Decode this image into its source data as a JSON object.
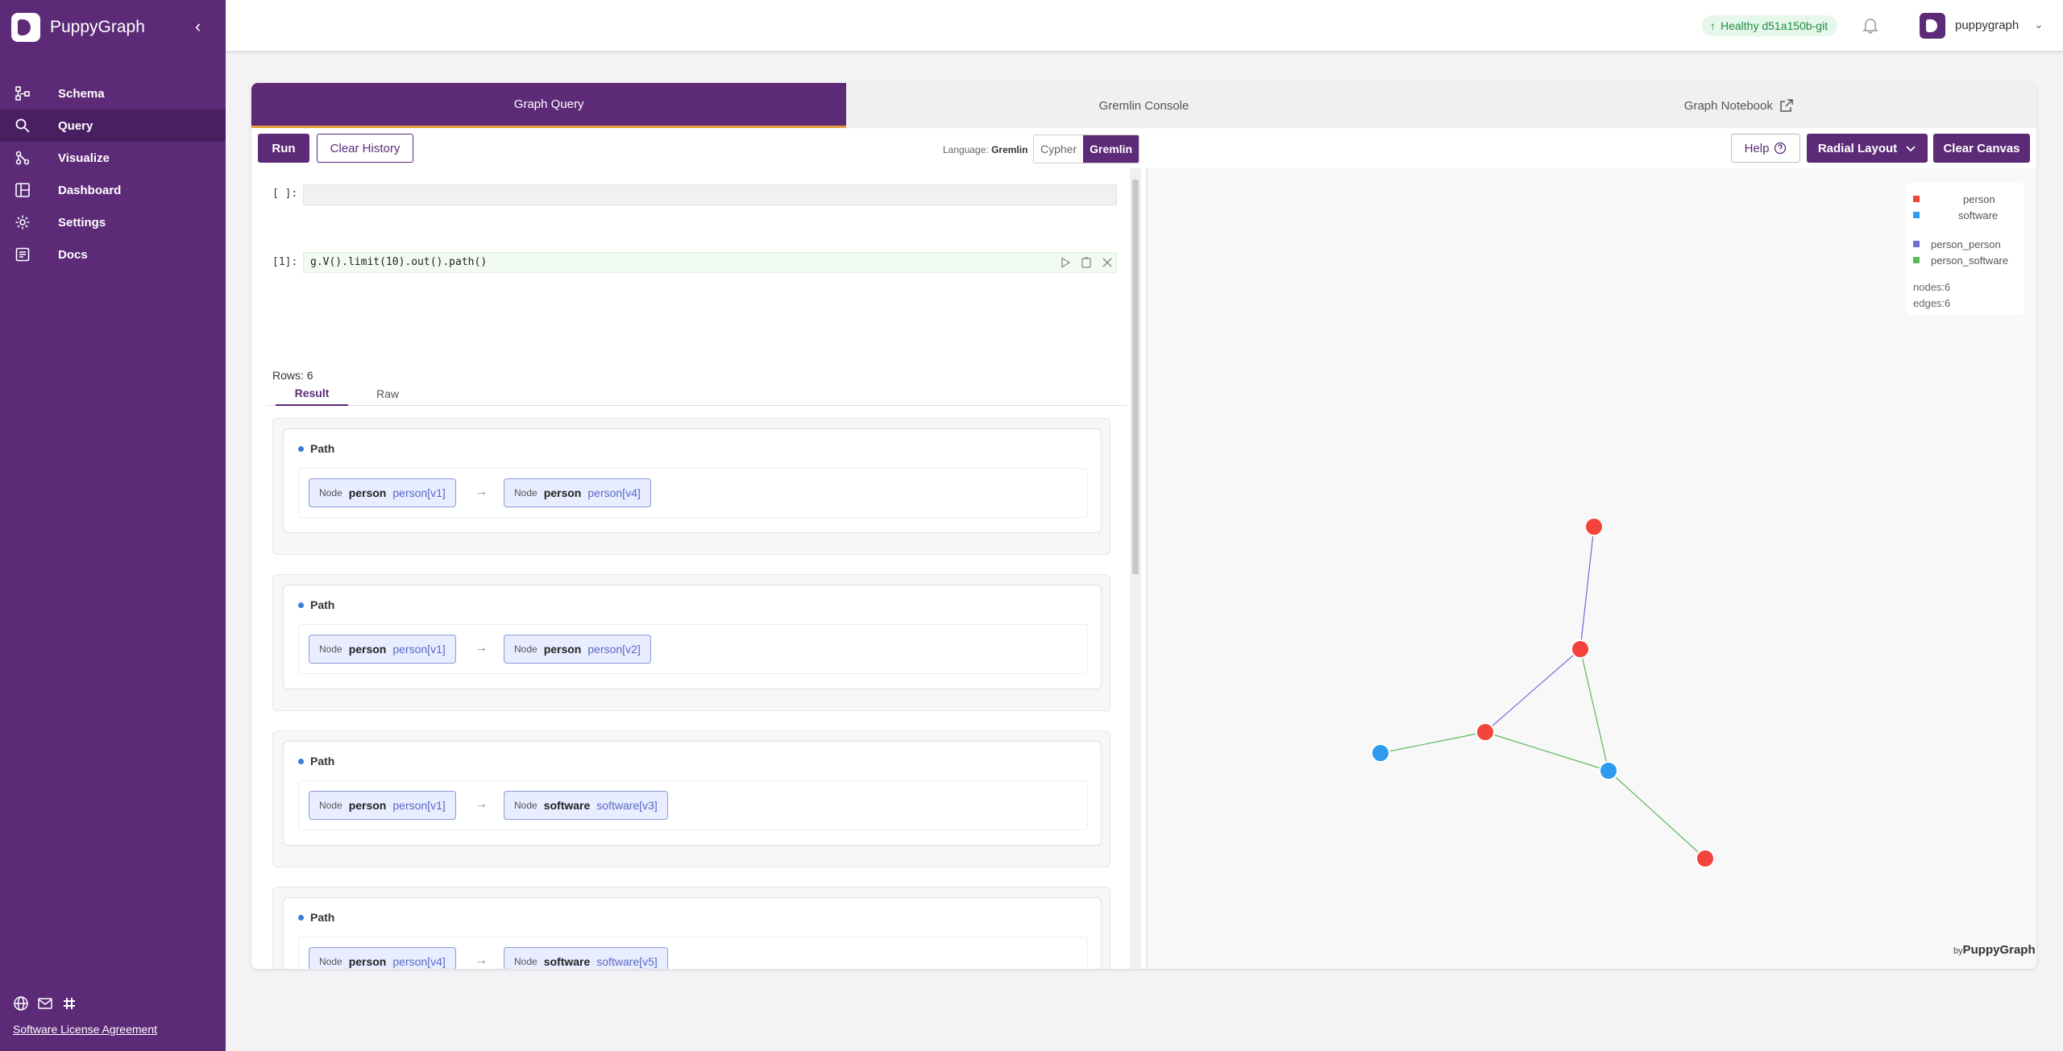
{
  "brand": {
    "name": "PuppyGraph"
  },
  "sidebar": {
    "items": [
      {
        "label": "Schema",
        "icon": "schema-icon"
      },
      {
        "label": "Query",
        "icon": "search-icon"
      },
      {
        "label": "Visualize",
        "icon": "visualize-icon"
      },
      {
        "label": "Dashboard",
        "icon": "dashboard-icon"
      },
      {
        "label": "Settings",
        "icon": "gear-icon"
      },
      {
        "label": "Docs",
        "icon": "docs-icon"
      }
    ],
    "license": "Software License Agreement"
  },
  "topbar": {
    "health": "Healthy d51a150b-git",
    "user": "puppygraph"
  },
  "tabs": [
    {
      "label": "Graph Query"
    },
    {
      "label": "Gremlin Console"
    },
    {
      "label": "Graph Notebook"
    }
  ],
  "toolbar": {
    "run": "Run",
    "clear_history": "Clear History",
    "language_label": "Language:",
    "language_value": "Gremlin",
    "lang_options": [
      "Cypher",
      "Gremlin"
    ],
    "help": "Help",
    "layout": "Radial Layout",
    "clear_canvas": "Clear Canvas"
  },
  "notebook": {
    "empty_prompt": "[ ]:",
    "cell_prompt": "[1]:",
    "cell_query": "g.V().limit(10).out().path()",
    "rows": "Rows: 6",
    "result_tabs": [
      "Result",
      "Raw"
    ],
    "paths": [
      {
        "title": "Path",
        "from": {
          "kind": "Node",
          "label": "person",
          "id": "person[v1]"
        },
        "to": {
          "kind": "Node",
          "label": "person",
          "id": "person[v4]"
        }
      },
      {
        "title": "Path",
        "from": {
          "kind": "Node",
          "label": "person",
          "id": "person[v1]"
        },
        "to": {
          "kind": "Node",
          "label": "person",
          "id": "person[v2]"
        }
      },
      {
        "title": "Path",
        "from": {
          "kind": "Node",
          "label": "person",
          "id": "person[v1]"
        },
        "to": {
          "kind": "Node",
          "label": "software",
          "id": "software[v3]"
        }
      },
      {
        "title": "Path",
        "from": {
          "kind": "Node",
          "label": "person",
          "id": "person[v4]"
        },
        "to": {
          "kind": "Node",
          "label": "software",
          "id": "software[v5]"
        }
      }
    ],
    "arrow": "→"
  },
  "legend": {
    "nodes": [
      {
        "label": "person",
        "color": "#f2443a"
      },
      {
        "label": "software",
        "color": "#2e9bf0"
      }
    ],
    "edges": [
      {
        "label": "person_person",
        "color": "#6b6fd6"
      },
      {
        "label": "person_software",
        "color": "#5cb85c"
      }
    ],
    "nodes_count": "nodes:6",
    "edges_count": "edges:6"
  },
  "colors": {
    "primary": "#5c2a77",
    "person": "#f2443a",
    "software": "#2e9bf0"
  },
  "watermark": {
    "by": "by",
    "name": "PuppyGraph"
  }
}
